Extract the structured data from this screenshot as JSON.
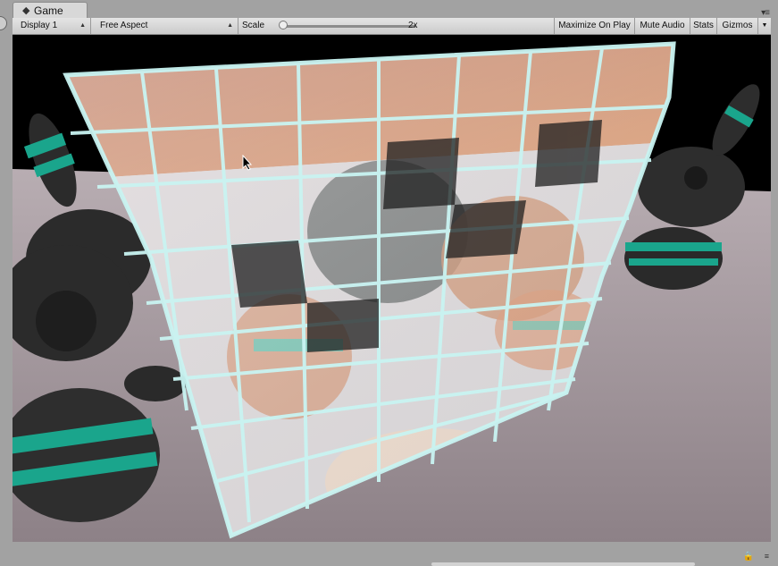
{
  "window": {
    "tab_title": "Game",
    "tab_icon": "unity-game-icon",
    "menu_icon": "window-menu-icon"
  },
  "toolbar": {
    "display": "Display 1",
    "aspect": "Free Aspect",
    "scale_label": "Scale",
    "scale_value": "2x",
    "scale_level": 0,
    "maximize_on_play": "Maximize On Play",
    "mute_audio": "Mute Audio",
    "stats": "Stats",
    "gizmos": "Gizmos"
  },
  "scene": {
    "description_colors": {
      "background": "#000000",
      "floor": "#a69aa1",
      "bunny": "#2a2a2a",
      "stripe": "#1aa58c",
      "glass_frame": "#9ee6e6",
      "warm_tile": "#b24a1e"
    }
  }
}
